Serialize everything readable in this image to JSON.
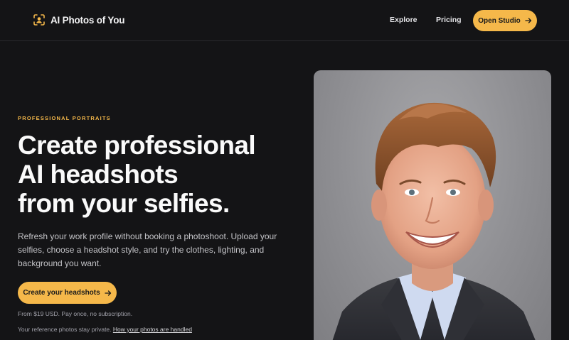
{
  "nav": {
    "brand": "AI Photos of You",
    "links": [
      {
        "label": "Explore"
      },
      {
        "label": "Pricing"
      }
    ],
    "cta_label": "Open Studio"
  },
  "hero": {
    "eyebrow": "PROFESSIONAL PORTRAITS",
    "headline_lines": [
      "Create professional",
      "AI headshots",
      "from your selfies."
    ],
    "lead_lines": [
      "Refresh your work profile without booking a photoshoot. Upload your",
      "selfies, choose a headshot style, and try the clothes, lighting, and",
      "background you want."
    ],
    "cta_label": "Create your headshots",
    "price_note": "From $19 USD. Pay once, no subscription.",
    "privacy_text": "Your reference photos stay private. ",
    "privacy_link": "How your photos are handled"
  },
  "colors": {
    "background": "#141416",
    "accent": "#f5b84a",
    "text": "#f4f4f5",
    "muted": "#a1a1aa"
  },
  "icons": {
    "brand": "face-scan-icon",
    "cta_arrow": "arrow-right-icon"
  },
  "image": {
    "subject": "smiling man with brown hair in dark blazer and light blue shirt against grey studio background"
  }
}
